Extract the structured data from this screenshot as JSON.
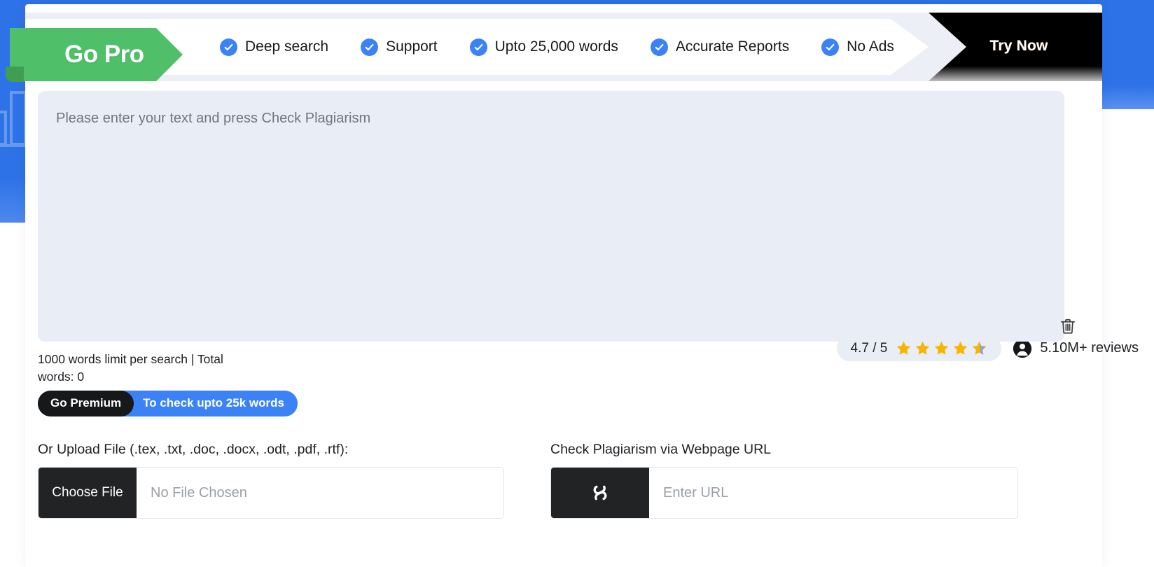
{
  "promo": {
    "tag_label": "Go Pro",
    "cta_label": "Try Now",
    "features": [
      {
        "label": "Deep search",
        "icon": "check-circle-icon"
      },
      {
        "label": "Support",
        "icon": "check-circle-icon"
      },
      {
        "label": "Upto 25,000 words",
        "icon": "check-circle-icon"
      },
      {
        "label": "Accurate Reports",
        "icon": "check-circle-icon"
      },
      {
        "label": "No Ads",
        "icon": "check-circle-icon"
      }
    ],
    "colors": {
      "tag_green": "#4fc069",
      "check_blue": "#3b82f6",
      "cta_black": "#000000"
    }
  },
  "editor": {
    "placeholder": "Please enter your text and press Check Plagiarism",
    "value": "",
    "clear_icon": "trash-icon",
    "word_limit_text": "1000 words limit per search | Total words: 0",
    "word_limit": 1000,
    "total_words": 0
  },
  "premium": {
    "button_label": "Go Premium",
    "tagline": "To check upto 25k words",
    "accent": "#3b82f6"
  },
  "rating": {
    "score_text": "4.7 / 5",
    "score": 4.7,
    "out_of": 5,
    "stars_full": 4,
    "stars_half": 1,
    "star_color": "#f7b500",
    "star_empty_color": "#9aa3af",
    "reviews_text": "5.10M+ reviews",
    "avatar_icon": "user-avatar-icon"
  },
  "upload": {
    "label": "Or Upload File (.tex, .txt, .doc, .docx, .odt, .pdf, .rtf):",
    "button_label": "Choose File",
    "placeholder": "No File Chosen",
    "value": ""
  },
  "url_check": {
    "label": "Check Plagiarism via Webpage URL",
    "button_icon": "link-chain-icon",
    "placeholder": "Enter URL",
    "value": ""
  }
}
